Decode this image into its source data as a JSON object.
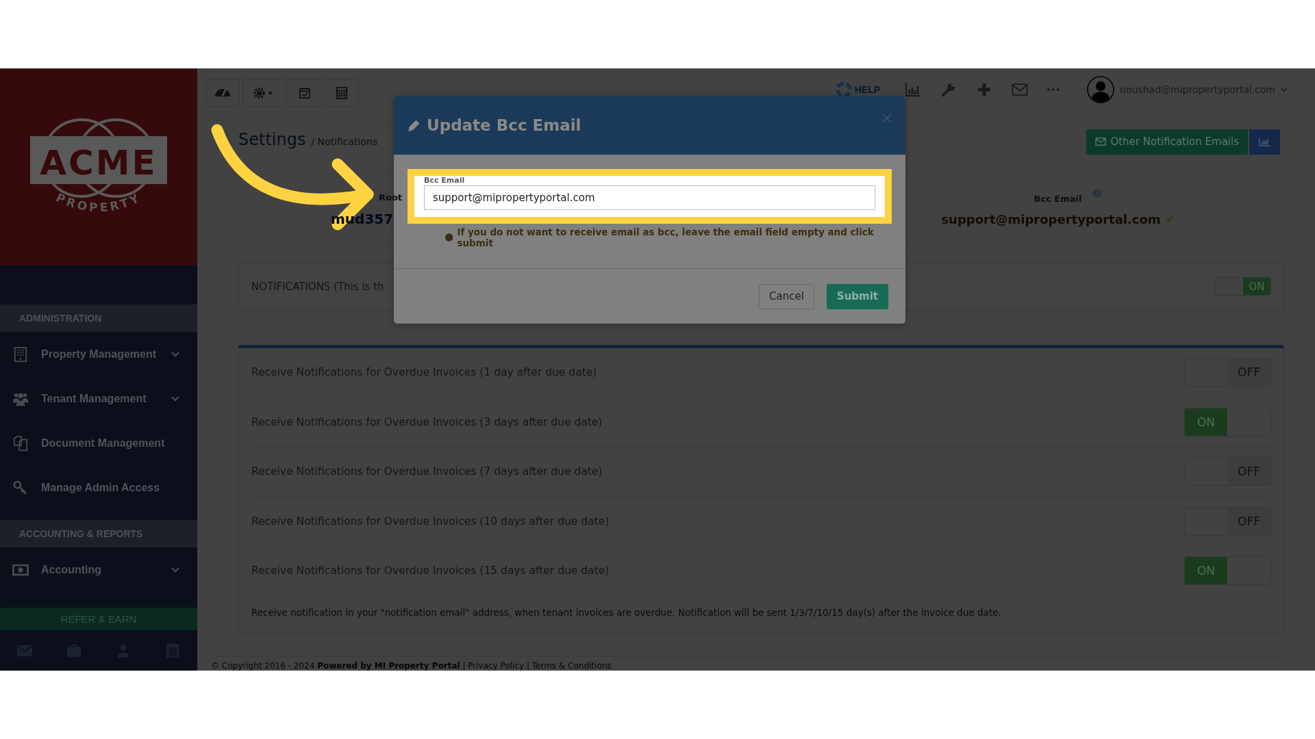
{
  "toolbar": [
    {
      "kind": "dashboard"
    },
    {
      "kind": "settings"
    },
    {
      "kind": "calendar"
    },
    {
      "kind": "calculator"
    }
  ],
  "top_nav": {
    "help": "HELP",
    "icons": [
      {
        "kind": "chart"
      },
      {
        "kind": "wrench"
      },
      {
        "kind": "plus"
      },
      {
        "kind": "mail"
      },
      {
        "kind": "more"
      }
    ],
    "user": "noushad@mipropertyportal.com"
  },
  "sidebar": {
    "logo": {
      "wordmark": "ACME",
      "tagline": "PROPERTY"
    },
    "sections": [
      {
        "title": "ADMINISTRATION",
        "items": [
          {
            "label": "Property Management",
            "expandable": true
          },
          {
            "label": "Tenant Management",
            "expandable": true
          },
          {
            "label": "Document Management",
            "expandable": false
          },
          {
            "label": "Manage Admin Access",
            "expandable": false
          }
        ]
      },
      {
        "title": "ACCOUNTING & REPORTS",
        "items": [
          {
            "label": "Accounting",
            "expandable": true
          }
        ]
      }
    ],
    "refer": "REFER & EARN",
    "bottom_icons": [
      {
        "kind": "mail"
      },
      {
        "kind": "briefcase"
      },
      {
        "kind": "user"
      },
      {
        "kind": "calculator"
      }
    ]
  },
  "page": {
    "title": "Settings",
    "breadcrumb": "/ Notifications",
    "other_button": "Other Notification Emails",
    "root_label": "Root",
    "root_value": "mud357",
    "bcc_label": "Bcc Email",
    "bcc_value": "support@mipropertyportal.com"
  },
  "master": {
    "label": "NOTIFICATIONS (This is th",
    "on": true,
    "state_text": "ON"
  },
  "rows": [
    {
      "label": "Receive Notifications for Overdue Invoices (1 day after due date)",
      "on": false,
      "state_text": "OFF"
    },
    {
      "label": "Receive Notifications for Overdue Invoices (3 days after due date)",
      "on": true,
      "state_text": "ON"
    },
    {
      "label": "Receive Notifications for Overdue Invoices (7 days after due date)",
      "on": false,
      "state_text": "OFF"
    },
    {
      "label": "Receive Notifications for Overdue Invoices (10 days after due date)",
      "on": false,
      "state_text": "OFF"
    },
    {
      "label": "Receive Notifications for Overdue Invoices (15 days after due date)",
      "on": true,
      "state_text": "ON"
    }
  ],
  "note": "Receive notification in your \"notification email\" address, when tenant invoices are overdue. Notification will be sent 1/3/7/10/15 day(s) after the invoice due date.",
  "footer": "© Copyright 2016 - 2024 **Powered by MI Property Portal** | Privacy Policy | Terms & Conditions",
  "modal": {
    "title": "Update Bcc Email",
    "field_label": "Bcc Email",
    "value": "support@mipropertyportal.com",
    "hint": "If you do not want to receive email as bcc, leave the email field empty and click submit",
    "buttons": [
      {
        "label": "Cancel",
        "kind": "secondary"
      },
      {
        "label": "Submit",
        "kind": "primary"
      }
    ]
  }
}
